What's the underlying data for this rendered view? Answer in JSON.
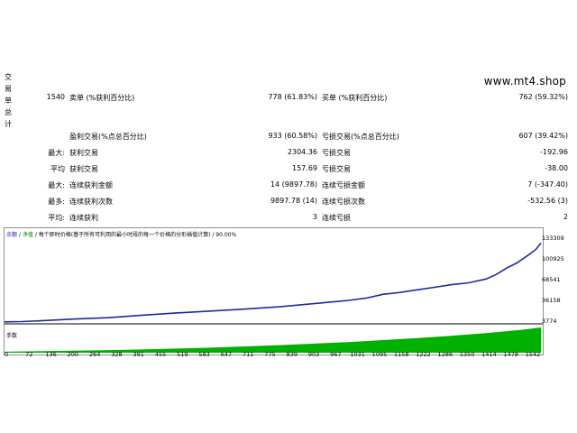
{
  "side_label": [
    "交",
    "易",
    "单",
    "总",
    "计"
  ],
  "site": "www.mt4.shop",
  "stats_rows": [
    {
      "c1": "1540",
      "l1": "卖单 (%获利百分比)",
      "v1": "778 (61.83%)",
      "l2": "买单 (%获利百分比)",
      "v2": "762 (59.32%)"
    },
    {
      "c1": "",
      "l1": "盈利交易(%点总百分比)",
      "v1": "933 (60.58%)",
      "l2": "亏损交易(%点总百分比)",
      "v2": "607 (39.42%)"
    },
    {
      "c1": "最大:",
      "l1": "获利交易",
      "v1": "2304.36",
      "l2": "亏损交易",
      "v2": "-192.96"
    },
    {
      "c1": "平均",
      "l1": "获利交易",
      "v1": "157.69",
      "l2": "亏损交易",
      "v2": "-38.00"
    },
    {
      "c1": "最大:",
      "l1": "连续获利金额",
      "v1": "14 (9897.78)",
      "l2": "连续亏损金额",
      "v2": "7 (-347.40)"
    },
    {
      "c1": "最多:",
      "l1": "连续获利次数",
      "v1": "9897.78 (14)",
      "l2": "连续亏损次数",
      "v2": "-532.56 (3)"
    },
    {
      "c1": "平均:",
      "l1": "连续获利",
      "v1": "3",
      "l2": "连续亏损",
      "v2": "2"
    }
  ],
  "chart_header": {
    "tab1": "余额",
    "sep1": "/",
    "tab2": "净值",
    "desc": "/ 每个即时价格(基于所有可利用的最小时段的每一个价格的分形插值计算) / 90.00%"
  },
  "lots_label": "手数",
  "colors": {
    "balance_line": "#1f2a9c",
    "lots_fill": "#00b000",
    "border": "#8f8f8f"
  },
  "chart_data": {
    "type": "line",
    "x_ticks": [
      0,
      72,
      136,
      200,
      264,
      328,
      391,
      455,
      519,
      583,
      647,
      711,
      775,
      839,
      903,
      967,
      1031,
      1095,
      1158,
      1222,
      1286,
      1350,
      1414,
      1478,
      1542
    ],
    "y_ticks": [
      3774,
      36158,
      68541,
      100925,
      133309
    ],
    "ylim": [
      3774,
      133309
    ],
    "xlim": [
      0,
      1560
    ],
    "series": [
      {
        "x": [
          0,
          50,
          100,
          200,
          300,
          400,
          500,
          600,
          700,
          800,
          900,
          1000,
          1050,
          1100,
          1150,
          1200,
          1250,
          1300,
          1350,
          1400,
          1430,
          1460,
          1490,
          1520,
          1545,
          1560
        ],
        "y": [
          4000,
          4500,
          5600,
          8400,
          10500,
          14500,
          18000,
          21000,
          24000,
          27500,
          32500,
          37500,
          41000,
          47000,
          50000,
          54000,
          58000,
          62000,
          65000,
          71000,
          78000,
          88000,
          96000,
          107000,
          117000,
          127000
        ]
      }
    ],
    "lots": {
      "x": [
        0,
        200,
        400,
        600,
        800,
        1000,
        1100,
        1200,
        1300,
        1400,
        1500,
        1560
      ],
      "y": [
        0.04,
        0.08,
        0.13,
        0.2,
        0.3,
        0.42,
        0.5,
        0.58,
        0.67,
        0.78,
        0.9,
        1.0
      ]
    }
  }
}
